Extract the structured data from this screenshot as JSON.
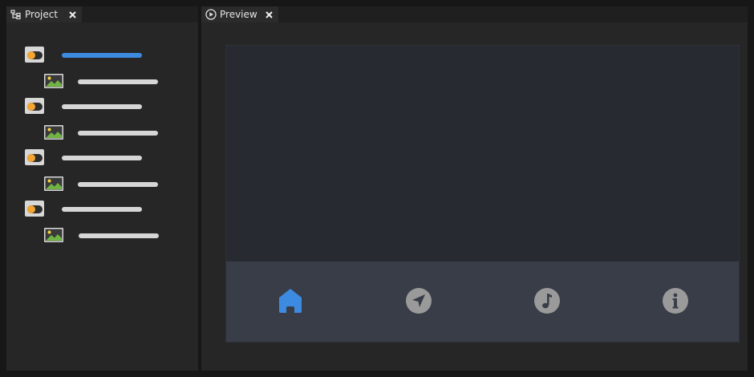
{
  "project_panel": {
    "tab_label": "Project",
    "tab_icon": "hierarchy-icon",
    "close_icon": "close-icon",
    "rows": [
      {
        "kind": "toggle",
        "active": true
      },
      {
        "kind": "image"
      },
      {
        "kind": "toggle",
        "active": false
      },
      {
        "kind": "image"
      },
      {
        "kind": "toggle",
        "active": false
      },
      {
        "kind": "image"
      },
      {
        "kind": "toggle",
        "active": false
      },
      {
        "kind": "image"
      }
    ]
  },
  "preview_panel": {
    "tab_label": "Preview",
    "tab_icon": "play-circle-icon",
    "close_icon": "close-icon",
    "nav_items": [
      {
        "icon": "home-icon",
        "selected": true
      },
      {
        "icon": "navigation-arrow-icon",
        "selected": false
      },
      {
        "icon": "music-note-icon",
        "selected": false
      },
      {
        "icon": "info-icon",
        "selected": false
      }
    ]
  },
  "colors": {
    "accent": "#3d8be0",
    "toggle_knob": "#f3a531",
    "nav_inactive": "#9a9a9a"
  }
}
